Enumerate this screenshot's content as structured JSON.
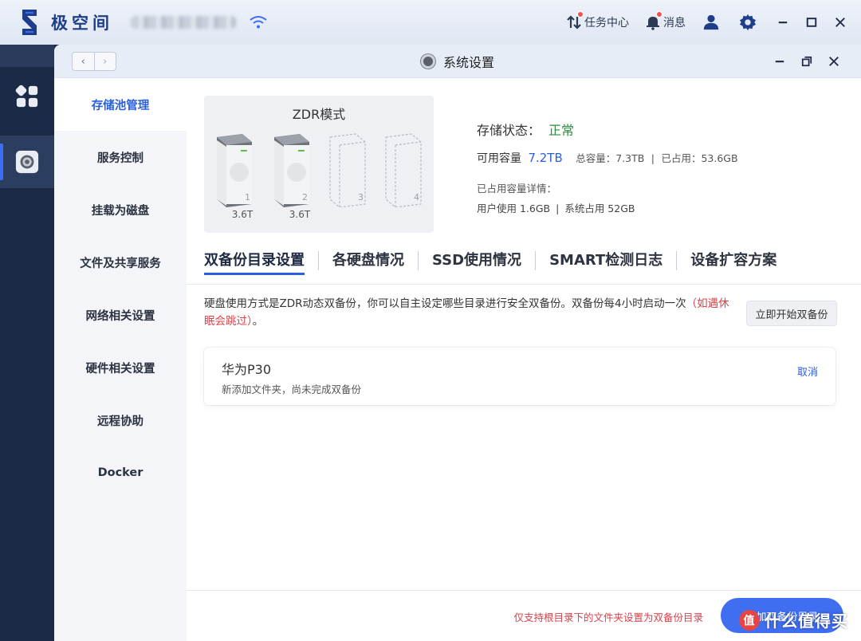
{
  "topbar": {
    "app_name": "极空间",
    "task_center": "任务中心",
    "messages": "消息",
    "icons": [
      "logo-icon",
      "wifi-icon",
      "task-center-icon",
      "bell-icon",
      "user-icon",
      "gear-icon",
      "minimize-icon",
      "maximize-icon",
      "close-icon"
    ]
  },
  "window": {
    "title": "系统设置",
    "nav_back": "‹",
    "nav_forward": "›"
  },
  "menu": {
    "items": [
      {
        "label": "存储池管理",
        "active": true
      },
      {
        "label": "服务控制"
      },
      {
        "label": "挂载为磁盘"
      },
      {
        "label": "文件及共享服务"
      },
      {
        "label": "网络相关设置"
      },
      {
        "label": "硬件相关设置"
      },
      {
        "label": "远程协助"
      },
      {
        "label": "Docker"
      }
    ]
  },
  "drives": {
    "mode": "ZDR模式",
    "slots": [
      {
        "num": "1",
        "size": "3.6T",
        "installed": true
      },
      {
        "num": "2",
        "size": "3.6T",
        "installed": true
      },
      {
        "num": "3",
        "size": "",
        "installed": false
      },
      {
        "num": "4",
        "size": "",
        "installed": false
      }
    ]
  },
  "status": {
    "label": "存储状态：",
    "value": "正常",
    "available_label": "可用容量",
    "available_value": "7.2TB",
    "total": "总容量：7.3TB",
    "sep": "|",
    "used": "已占用：53.6GB",
    "detail_title": "已占用容量详情：",
    "user_used": "用户使用 1.6GB",
    "system_used": "系统占用 52GB"
  },
  "tabs": [
    {
      "label": "双备份目录设置",
      "active": true
    },
    {
      "label": "各硬盘情况"
    },
    {
      "label": "SSD使用情况"
    },
    {
      "label": "SMART检测日志"
    },
    {
      "label": "设备扩容方案"
    }
  ],
  "backup": {
    "description": "硬盘使用方式是ZDR动态双备份，你可以自主设定哪些目录进行安全双备份。双备份每4小时启动一次",
    "description_red": "（如遇休眠会跳过）",
    "description_end": "。",
    "start_button": "立即开始双备份",
    "folders": [
      {
        "name": "华为P30",
        "note": "新添加文件夹，尚未完成双备份",
        "action": "取消"
      }
    ],
    "footer_note": "仅支持根目录下的文件夹设置为双备份目录",
    "footer_button": "添加双备份目录"
  },
  "watermark": {
    "badge": "值",
    "text": "什么值得买"
  },
  "colors": {
    "accent": "#2a5fe0",
    "ok": "#2e8b3e",
    "warn": "#d9434b",
    "dock": "#1b2a47"
  }
}
